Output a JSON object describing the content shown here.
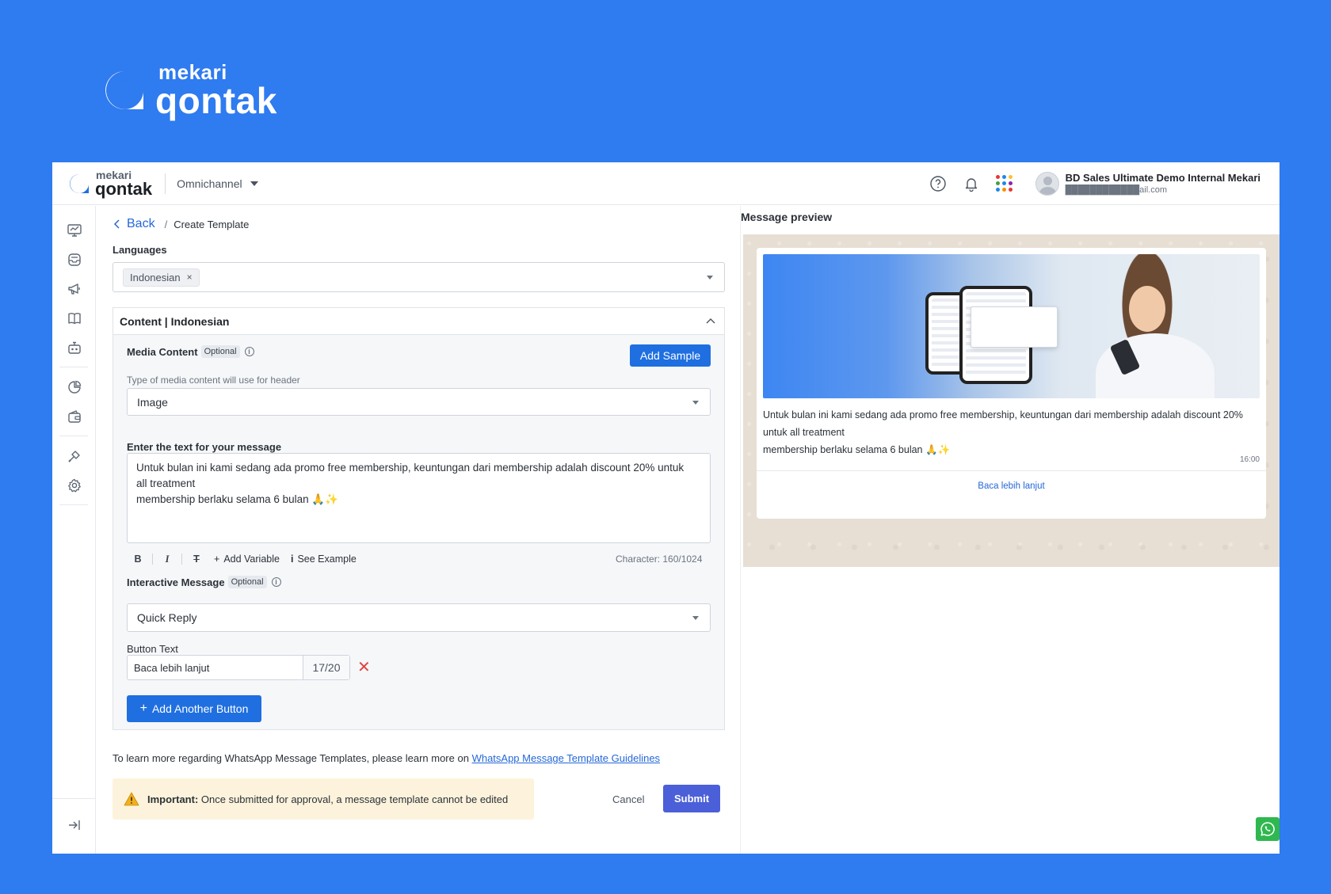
{
  "brand": {
    "small": "mekari",
    "big": "qontak"
  },
  "topbar": {
    "logo_small": "mekari",
    "logo_big": "qontak",
    "product": "Omnichannel",
    "user_name": "BD Sales Ultimate Demo Internal Mekari",
    "user_email": "████████████ail.com",
    "apps_colors": [
      "#e53935",
      "#1e88e5",
      "#fbc02d",
      "#43a047",
      "#1e88e5",
      "#8e24aa",
      "#1e88e5",
      "#fb8c00",
      "#e53935"
    ]
  },
  "sidebar": {
    "icons": [
      "monitor-icon",
      "inbox-icon",
      "megaphone-icon",
      "book-icon",
      "bot-icon",
      "chart-icon",
      "wallet-icon",
      "tools-icon",
      "settings-icon"
    ],
    "collapse_icon": "collapse-icon"
  },
  "breadcrumb": {
    "back": "Back",
    "separator": "/",
    "current": "Create Template"
  },
  "languages": {
    "label": "Languages",
    "selected": "Indonesian",
    "remove": "×"
  },
  "content": {
    "title": "Content | Indonesian",
    "media": {
      "label": "Media Content",
      "optional": "Optional",
      "add_sample": "Add Sample",
      "hint": "Type of media content will use for header",
      "type_value": "Image"
    },
    "message": {
      "label": "Enter the text for your message",
      "line1": "Untuk bulan ini kami sedang ada promo free membership, keuntungan dari membership adalah discount 20% untuk",
      "line2": "all treatment",
      "line3": "membership berlaku selama 6 bulan 🙏✨",
      "add_variable": "Add Variable",
      "see_example": "See Example",
      "char_count": "Character: 160/1024"
    },
    "interactive": {
      "label": "Interactive Message",
      "optional": "Optional",
      "type_value": "Quick Reply",
      "button_text_label": "Button Text",
      "button_text_value": "Baca lebih lanjut",
      "button_text_count": "17/20",
      "remove": "✕",
      "add_button": "Add Another Button"
    }
  },
  "footer": {
    "learn_text": "To learn more regarding WhatsApp Message Templates, please learn more on ",
    "learn_link": "WhatsApp Message Template Guidelines",
    "important_label": "Important:",
    "important_text": " Once submitted for approval, a message template cannot be edited",
    "cancel": "Cancel",
    "submit": "Submit"
  },
  "preview": {
    "title": "Message preview",
    "line1": "Untuk bulan ini kami sedang ada promo free membership, keuntungan dari membership adalah discount 20%",
    "line2": "untuk all treatment",
    "line3": "membership berlaku selama 6 bulan 🙏✨",
    "time": "16:00",
    "button": "Baca lebih lanjut"
  },
  "colors": {
    "page_bg": "#2f7bf0",
    "primary": "#1f6fe0",
    "submit": "#4b5fd8",
    "warning_bg": "#fdf3dc",
    "whatsapp": "#2fb84f"
  }
}
